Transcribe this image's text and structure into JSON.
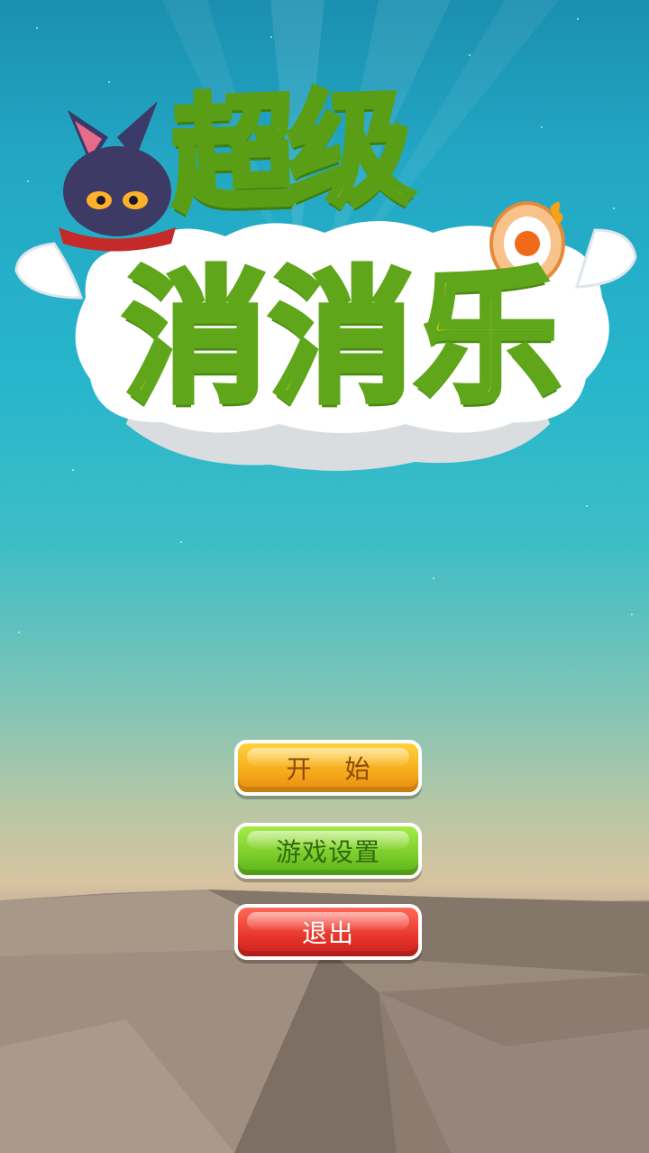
{
  "title": {
    "line1": "超级",
    "line2": "消消乐"
  },
  "menu": {
    "start_label": "开 始",
    "settings_label": "游戏设置",
    "exit_label": "退出"
  },
  "colors": {
    "sky_top": "#1b8fb0",
    "sky_mid": "#27b6cc",
    "horizon": "#d8c3a0",
    "ground": "#8f8074",
    "start_button": "#f7a91c",
    "settings_button": "#79cc2a",
    "exit_button": "#e8352c",
    "title_green": "#9fd23a",
    "title_yellow": "#ffe21a"
  }
}
